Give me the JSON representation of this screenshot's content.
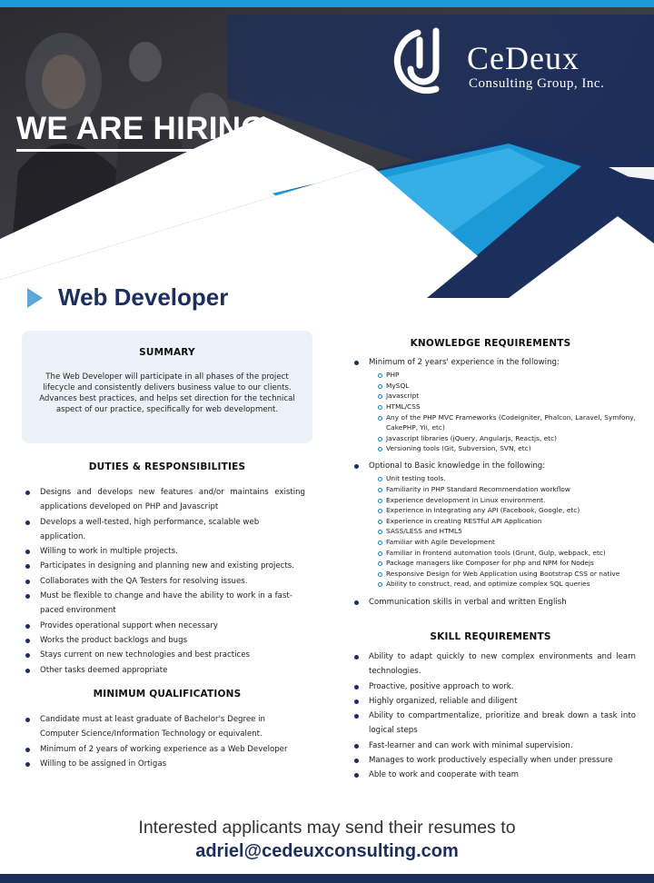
{
  "header": {
    "hiring_text": "WE ARE HIRING.",
    "logo_name": "CeDeux",
    "logo_sub": "Consulting Group, Inc."
  },
  "job_title": "Web Developer",
  "summary": {
    "heading": "SUMMARY",
    "text": "The Web Developer will participate in all phases of the project lifecycle and consistently delivers business value to our clients. Advances best practices, and helps set direction for the technical aspect of our practice, specifically for web development."
  },
  "duties": {
    "heading": "DUTIES & RESPONSIBILITIES",
    "items": [
      "Designs and develops new features and/or maintains existing applications developed on PHP and Javascript",
      "Develops a well-tested, high performance, scalable web application.",
      "Willing to work in multiple projects.",
      "Participates in designing and planning new and existing projects.",
      "Collaborates with the QA Testers for resolving issues.",
      "Must be flexible to change and have the ability to work in a fast-paced environment",
      "Provides operational support when necessary",
      "Works the product backlogs and bugs",
      "Stays current on new technologies and best practices",
      "Other tasks deemed appropriate"
    ]
  },
  "qualifications": {
    "heading": "MINIMUM QUALIFICATIONS",
    "items": [
      "Candidate must at least graduate of Bachelor's Degree in Computer Science/Information Technology or equivalent.",
      "Minimum of 2 years of working experience as a Web Developer",
      "Willing to be assigned in Ortigas"
    ]
  },
  "knowledge": {
    "heading": "KNOWLEDGE REQUIREMENTS",
    "group1": {
      "label": "Minimum of 2 years' experience in the following:",
      "items": [
        "PHP",
        "MySQL",
        "Javascript",
        "HTML/CSS",
        "Any of the PHP MVC Frameworks (Codeigniter, Phalcon, Laravel, Symfony, CakePHP, Yii, etc)",
        "Javascript libraries (jQuery, Angularjs, Reactjs, etc)",
        "Versioning tools (Git, Subversion, SVN, etc)"
      ]
    },
    "group2": {
      "label": "Optional to Basic knowledge in the following:",
      "items": [
        "Unit testing tools.",
        "Familiarity in PHP Standard Recommendation workflow",
        "Experience development in Linux environment.",
        "Experience in integrating any API (Facebook, Google, etc)",
        "Experience in creating RESTful API Application",
        "SASS/LESS and HTML5",
        "Familiar with Agile Development",
        "Familiar in frontend automation tools (Grunt, Gulp, webpack, etc)",
        "Package managers like Composer for php and NPM for Nodejs",
        "Responsive Design for Web Application using Bootstrap CSS or native",
        "Ability to construct, read, and optimize complex SQL queries"
      ]
    },
    "extra": "Communication skills in verbal and written English"
  },
  "skills": {
    "heading": "SKILL REQUIREMENTS",
    "items": [
      "Ability to adapt quickly to new complex environments and learn technologies.",
      "Proactive, positive approach to work.",
      "Highly organized, reliable and diligent",
      "Ability to compartmentalize, prioritize and break down a task into logical steps",
      "Fast-learner and can work with minimal supervision.",
      "Manages to work productively especially when under pressure",
      "Able to work and cooperate with team"
    ]
  },
  "footer": {
    "cta": "Interested applicants may send their resumes to",
    "email": "adriel@cedeuxconsulting.com"
  },
  "colors": {
    "navy": "#1c2e5c",
    "accent_blue": "#1a9ad6",
    "light_blue": "#5ea7d9",
    "summary_bg": "#edf2fa"
  }
}
